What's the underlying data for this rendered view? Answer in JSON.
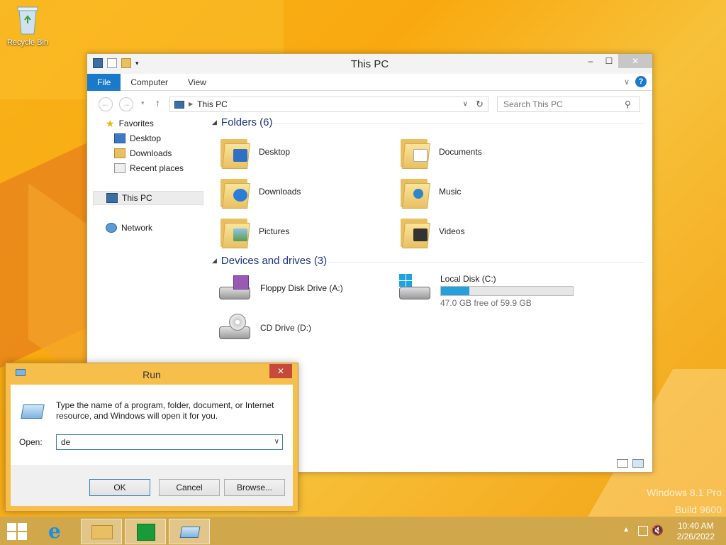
{
  "desktop": {
    "recycle_bin_label": "Recycle Bin",
    "watermark_line1": "Windows 8.1 Pro",
    "watermark_line2": "Build 9600"
  },
  "explorer": {
    "title": "This PC",
    "ribbon_tabs": [
      "File",
      "Computer",
      "View"
    ],
    "address": "This PC",
    "search_placeholder": "Search This PC",
    "nav": {
      "favorites": "Favorites",
      "desktop": "Desktop",
      "downloads": "Downloads",
      "recent": "Recent places",
      "this_pc": "This PC",
      "network": "Network"
    },
    "folders_header": "Folders (6)",
    "folders": [
      "Desktop",
      "Documents",
      "Downloads",
      "Music",
      "Pictures",
      "Videos"
    ],
    "devices_header": "Devices and drives (3)",
    "drives": {
      "floppy": "Floppy Disk Drive (A:)",
      "local": "Local Disk (C:)",
      "local_free": "47.0 GB free of 59.9 GB",
      "local_used_fraction": 0.215,
      "cd": "CD Drive (D:)"
    }
  },
  "run": {
    "title": "Run",
    "message": "Type the name of a program, folder, document, or Internet resource, and Windows will open it for you.",
    "open_label": "Open:",
    "open_value": "de",
    "ok": "OK",
    "cancel": "Cancel",
    "browse": "Browse..."
  },
  "taskbar": {
    "time": "10:40 AM",
    "date": "2/26/2022"
  }
}
